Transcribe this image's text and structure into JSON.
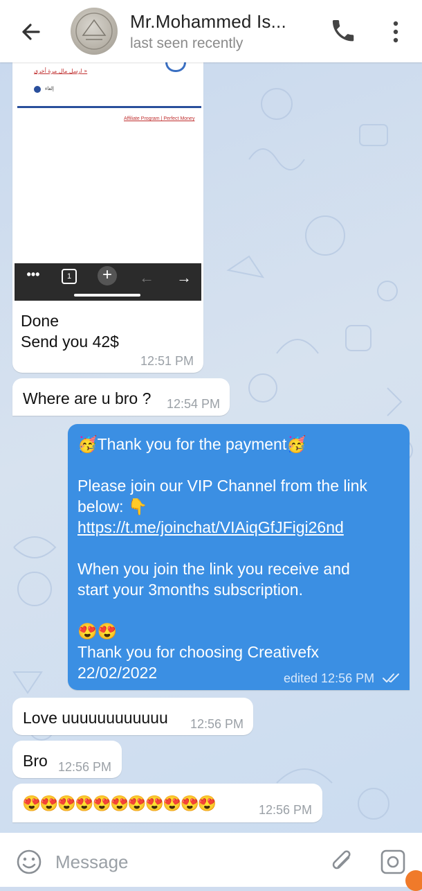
{
  "header": {
    "title": "Mr.Mohammed Is...",
    "status": "last seen recently"
  },
  "screenshot_preview": {
    "arabic_link": "ارسل مال مرة أخرى »",
    "small_label": "إلغاء",
    "footer_links": "Affiliate Program | Perfect Money"
  },
  "messages": [
    {
      "id": "m1",
      "direction": "in",
      "text": "Done\nSend you 42$",
      "time": "12:51 PM"
    },
    {
      "id": "m2",
      "direction": "in",
      "text": "Where are u bro ?",
      "time": "12:54 PM"
    },
    {
      "id": "m3",
      "direction": "out",
      "line1": "🥳Thank you for the payment🥳",
      "line2": "Please join our VIP Channel from the link",
      "line3": "below: 👇",
      "link": "https://t.me/joinchat/VIAiqGfJFigi26nd",
      "line4": "When you join the link you receive and",
      "line5": "start your 3months subscription.",
      "line6": "😍😍",
      "line7": "Thank you for choosing Creativefx",
      "line8": "22/02/2022",
      "time": "edited 12:56 PM"
    },
    {
      "id": "m4",
      "direction": "in",
      "text": "Love uuuuuuuuuuuu",
      "time": "12:56 PM"
    },
    {
      "id": "m5",
      "direction": "in",
      "text": "Bro",
      "time": "12:56 PM"
    },
    {
      "id": "m6",
      "direction": "in",
      "text": "😍😍😍😍😍😍😍😍😍😍😍",
      "time": "12:56 PM"
    }
  ],
  "input": {
    "placeholder": "Message"
  },
  "colors": {
    "outgoing_bubble": "#3b8fe3",
    "incoming_bubble": "#ffffff",
    "background": "#cfdcef"
  },
  "icons": [
    "back-arrow-icon",
    "phone-icon",
    "more-vert-icon",
    "emoji-icon",
    "attach-icon",
    "camera-icon",
    "double-check-icon"
  ]
}
